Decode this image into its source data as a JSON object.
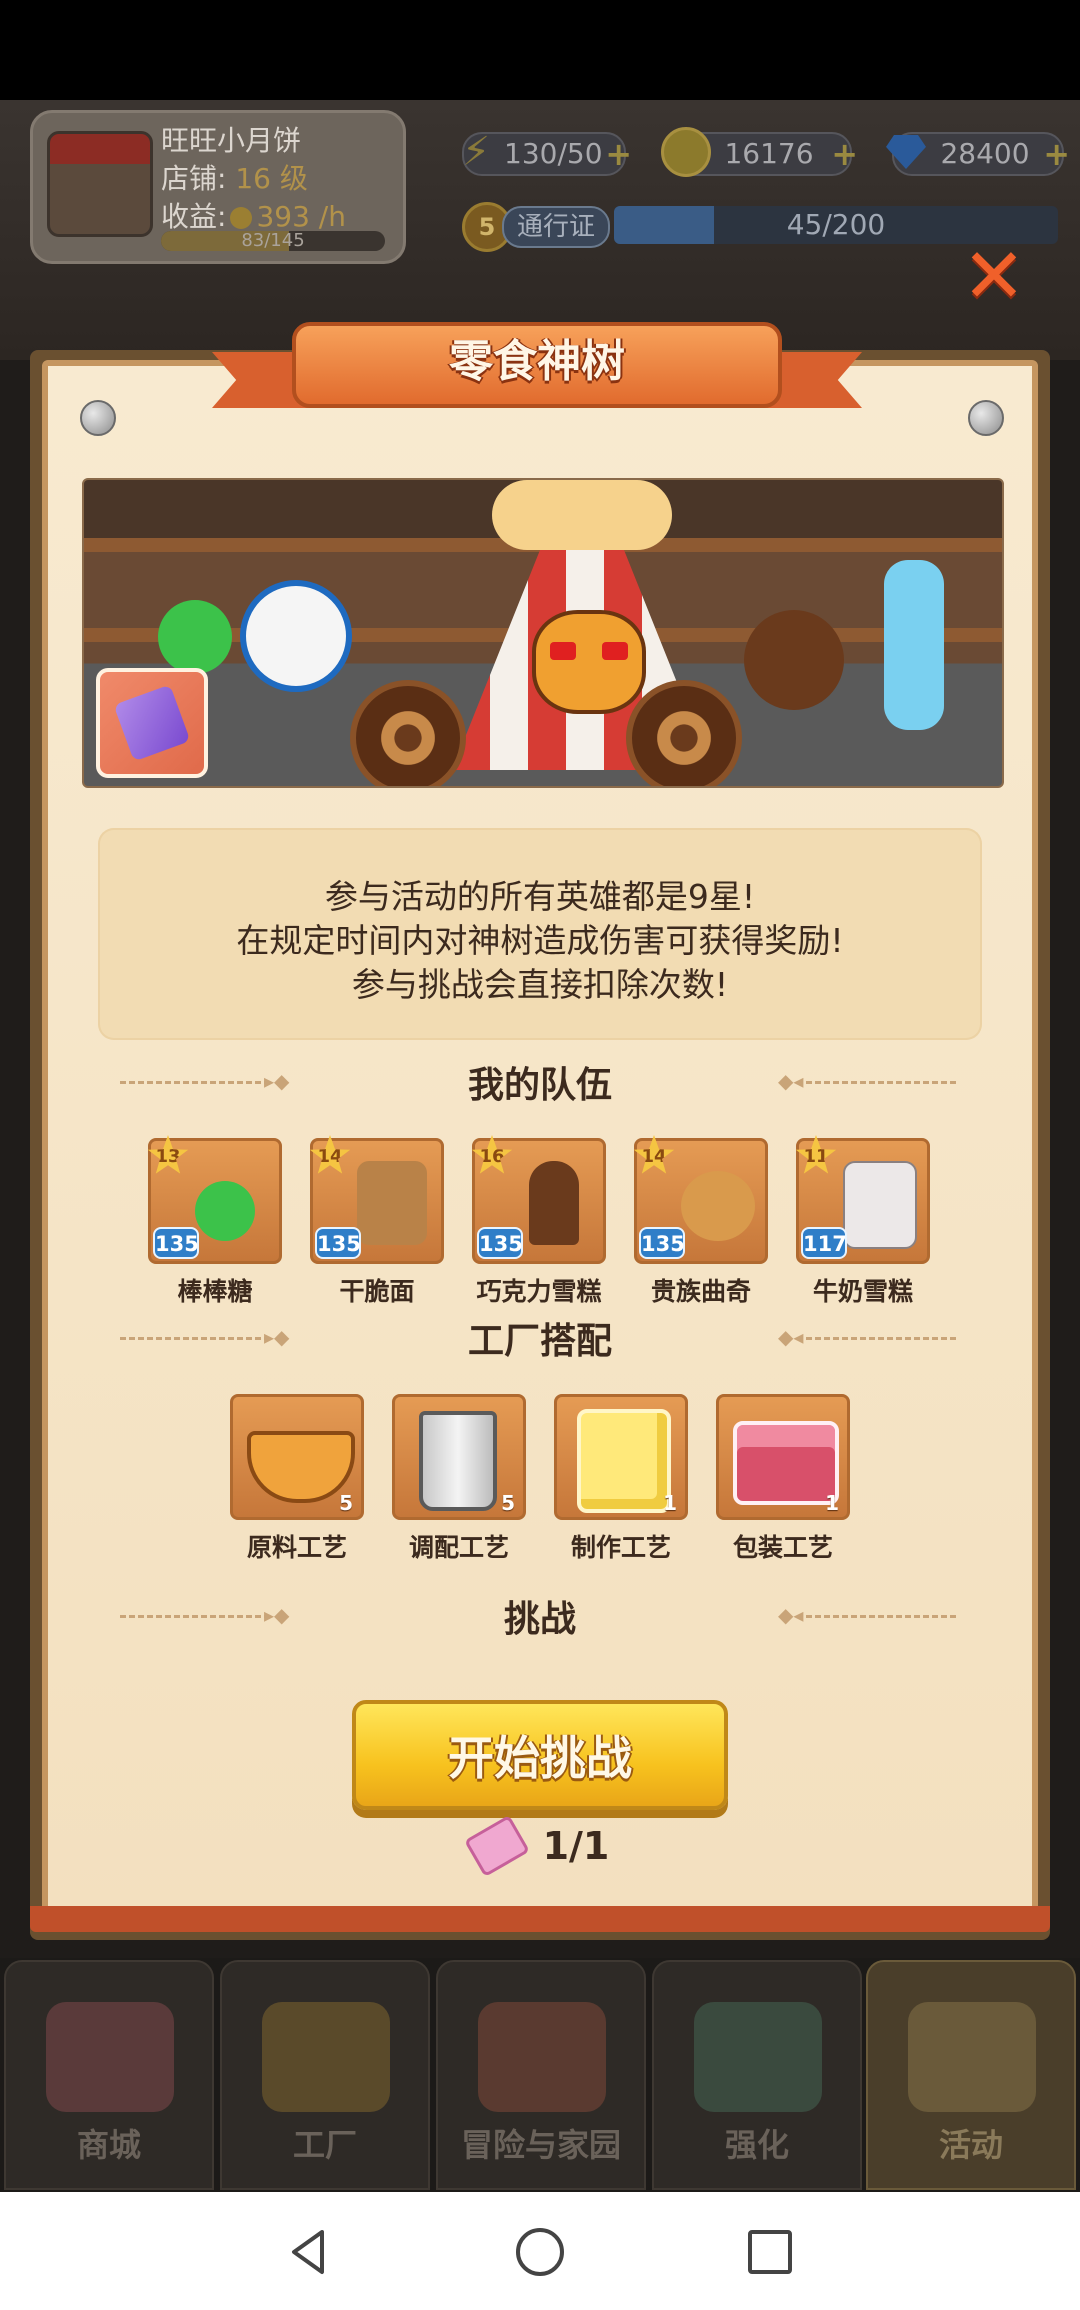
{
  "hud": {
    "shop_name": "旺旺小月饼",
    "shop_level_label": "店铺:",
    "shop_level_value": "16 级",
    "income_label": "收益:",
    "income_value": "393 /h",
    "xp_text": "83/145",
    "xp_progress": 0.57,
    "energy": "130/50",
    "coins": "16176",
    "gems": "28400",
    "pass_level": "5",
    "pass_label": "通行证",
    "pass_progress_text": "45/200",
    "pass_progress": 0.225,
    "energy_icon": "lightning-icon",
    "coin_icon": "coin-icon",
    "gem_icon": "diamond-icon",
    "close_icon": "close-x-icon"
  },
  "modal": {
    "title": "零食神树",
    "description": [
      "参与活动的所有英雄都是9星!",
      "在规定时间内对神树造成伤害可获得奖励!",
      "参与挑战会直接扣除次数!"
    ],
    "team_title": "我的队伍",
    "heroes": [
      {
        "name": "棒棒糖",
        "star": "13",
        "level": "135",
        "color": "#3cc24a"
      },
      {
        "name": "干脆面",
        "star": "14",
        "level": "135",
        "color": "#c9934a"
      },
      {
        "name": "巧克力雪糕",
        "star": "16",
        "level": "135",
        "color": "#6a3a1c"
      },
      {
        "name": "贵族曲奇",
        "star": "14",
        "level": "135",
        "color": "#d99a4c"
      },
      {
        "name": "牛奶雪糕",
        "star": "11",
        "level": "117",
        "color": "#e8e4e4"
      }
    ],
    "factory_title": "工厂搭配",
    "factory": [
      {
        "name": "原料工艺",
        "count": "5",
        "icon": "bowl-icon"
      },
      {
        "name": "调配工艺",
        "count": "5",
        "icon": "measuring-cup-icon"
      },
      {
        "name": "制作工艺",
        "count": "1",
        "icon": "butter-cubes-icon"
      },
      {
        "name": "包装工艺",
        "count": "1",
        "icon": "box-icon"
      }
    ],
    "challenge_title": "挑战",
    "start_button": "开始挑战",
    "tickets": "1/1"
  },
  "bottom_nav": [
    {
      "label": "商城",
      "active": false
    },
    {
      "label": "工厂",
      "active": false
    },
    {
      "label": "冒险与家园",
      "active": false
    },
    {
      "label": "强化",
      "active": false
    },
    {
      "label": "活动",
      "active": true
    }
  ],
  "colors": {
    "accent_orange": "#e16b2e",
    "button_yellow": "#f7c21e",
    "parchment": "#f6e6c8",
    "hero_level_blue": "#2f7ec8"
  }
}
